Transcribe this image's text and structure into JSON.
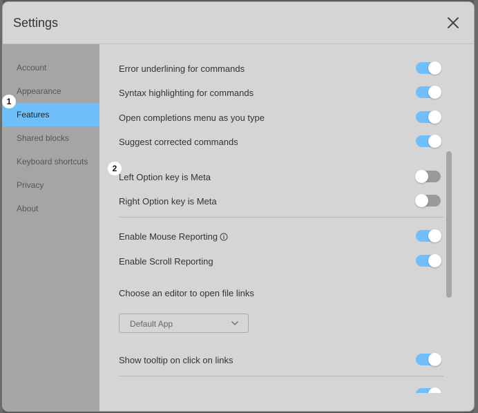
{
  "window": {
    "title": "Settings"
  },
  "sidebar": {
    "items": [
      {
        "label": "Account",
        "active": false
      },
      {
        "label": "Appearance",
        "active": false
      },
      {
        "label": "Features",
        "active": true
      },
      {
        "label": "Shared blocks",
        "active": false
      },
      {
        "label": "Keyboard shortcuts",
        "active": false
      },
      {
        "label": "Privacy",
        "active": false
      },
      {
        "label": "About",
        "active": false
      }
    ]
  },
  "features": {
    "settings": [
      {
        "label": "Error underlining for commands",
        "enabled": true
      },
      {
        "label": "Syntax highlighting for commands",
        "enabled": true
      },
      {
        "label": "Open completions menu as you type",
        "enabled": true
      },
      {
        "label": "Suggest corrected commands",
        "enabled": true
      },
      {
        "label": "Left Option key is Meta",
        "enabled": false
      },
      {
        "label": "Right Option key is Meta",
        "enabled": false
      },
      {
        "label": "Enable Mouse Reporting",
        "enabled": true,
        "icon": "info-icon"
      },
      {
        "label": "Enable Scroll Reporting",
        "enabled": true
      },
      {
        "label": "Show tooltip on click on links",
        "enabled": true
      }
    ],
    "editor_prompt": "Choose an editor to open file links",
    "editor_select": {
      "value": "Default App",
      "icon": "chevron-down-icon"
    }
  },
  "annotations": {
    "badge1": "1",
    "badge2": "2"
  },
  "colors": {
    "accent": "#6fbffa",
    "toggle_off": "#9a9a9a",
    "sidebar_bg": "#a5a5a5",
    "modal_bg": "#d5d5d5"
  }
}
